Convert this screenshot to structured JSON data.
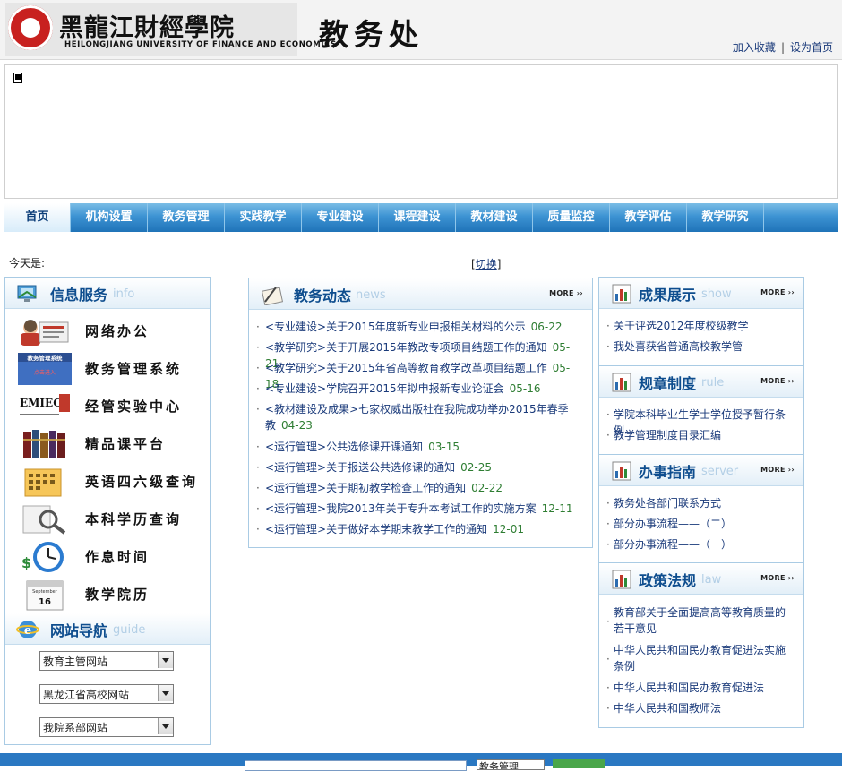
{
  "header": {
    "school_cn": "黑龍江財經學院",
    "school_en": "HEILONGJIANG UNIVERSITY OF FINANCE AND ECONOMICS",
    "dept": "教务处",
    "links": [
      "加入收藏",
      "设为首页"
    ]
  },
  "nav": [
    {
      "label": "首页",
      "active": true
    },
    {
      "label": "机构设置"
    },
    {
      "label": "教务管理"
    },
    {
      "label": "实践教学"
    },
    {
      "label": "专业建设"
    },
    {
      "label": "课程建设"
    },
    {
      "label": "教材建设"
    },
    {
      "label": "质量监控"
    },
    {
      "label": "教学评估"
    },
    {
      "label": "教学研究"
    }
  ],
  "today_label": "今天是:",
  "switch_label": "切换",
  "info_service": {
    "title": "信息服务",
    "sub": "info",
    "items": [
      {
        "label": "网络办公",
        "icon": "network-office-icon"
      },
      {
        "label": "教务管理系统",
        "icon": "academic-system-icon"
      },
      {
        "label": "经管实验中心",
        "icon": "emiec-logo-icon"
      },
      {
        "label": "精品课平台",
        "icon": "books-icon"
      },
      {
        "label": "英语四六级查询",
        "icon": "cet-query-icon"
      },
      {
        "label": "本科学历查询",
        "icon": "degree-query-icon"
      },
      {
        "label": "作息时间",
        "icon": "clock-icon"
      },
      {
        "label": "教学院历",
        "icon": "calendar-icon"
      }
    ],
    "icon_texts": {
      "system": "教务管理系统",
      "entry": "点击进入",
      "emiec": "EMIEC",
      "calendar_month": "September",
      "calendar_day": "16"
    }
  },
  "site_nav": {
    "title": "网站导航",
    "sub": "guide",
    "selects": [
      "教育主管网站",
      "黑龙江省高校网站",
      "我院系部网站"
    ]
  },
  "news": {
    "title": "教务动态",
    "sub": "news",
    "more": "MORE",
    "items": [
      {
        "text": "<专业建设>关于2015年度新专业申报相关材料的公示",
        "date": "06-22"
      },
      {
        "text": "<教学研究>关于开展2015年教改专项项目结题工作的通知",
        "date": "05-21"
      },
      {
        "text": "<教学研究>关于2015年省高等教育教学改革项目结题工作",
        "date": "05-18"
      },
      {
        "text": "<专业建设>学院召开2015年拟申报新专业论证会",
        "date": "05-16"
      },
      {
        "text": "<教材建设及成果>七家权威出版社在我院成功举办2015年春季教",
        "date": "04-23"
      },
      {
        "text": "<运行管理>公共选修课开课通知",
        "date": "03-15"
      },
      {
        "text": "<运行管理>关于报送公共选修课的通知",
        "date": "02-25"
      },
      {
        "text": "<运行管理>关于期初教学检查工作的通知",
        "date": "02-22"
      },
      {
        "text": "<运行管理>我院2013年关于专升本考试工作的实施方案",
        "date": "12-11"
      },
      {
        "text": "<运行管理>关于做好本学期末教学工作的通知",
        "date": "12-01"
      }
    ]
  },
  "achievements": {
    "title": "成果展示",
    "sub": "show",
    "more": "MORE",
    "items": [
      "关于评选2012年度校级教学",
      "我处喜获省普通高校教学管"
    ]
  },
  "rules": {
    "title": "规章制度",
    "sub": "rule",
    "more": "MORE",
    "items": [
      "学院本科毕业生学士学位授予暂行条例",
      "教学管理制度目录汇编"
    ]
  },
  "guide": {
    "title": "办事指南",
    "sub": "server",
    "more": "MORE",
    "items": [
      "教务处各部门联系方式",
      "部分办事流程——（二）",
      "部分办事流程——（一）"
    ]
  },
  "law": {
    "title": "政策法规",
    "sub": "law",
    "more": "MORE",
    "items": [
      "教育部关于全面提高高等教育质量的若干意见",
      "中华人民共和国民办教育促进法实施条例",
      "中华人民共和国民办教育促进法",
      "中华人民共和国教师法"
    ]
  },
  "footer": {
    "select_value": "教务管理"
  },
  "colors": {
    "nav_blue": "#1f73b8",
    "title_blue": "#0e4d8e",
    "date_green": "#2e7d32",
    "footer_blue": "#2a78c2"
  }
}
